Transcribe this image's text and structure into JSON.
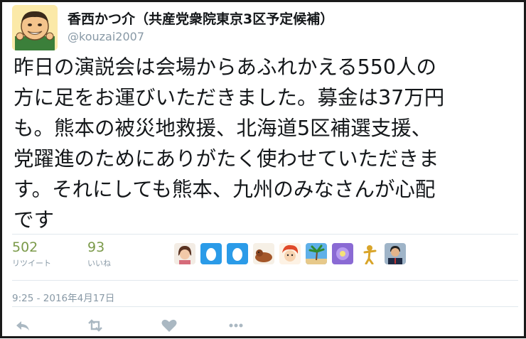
{
  "tweet": {
    "display_name": "香西かつ介（共産党衆院東京3区予定候補）",
    "handle": "@kouzai2007",
    "text_lines": [
      "昨日の演説会は会場からあふれかえる550人の",
      "方に足をお運びいただきました。募金は37万円",
      "も。熊本の被災地救援、北海道5区補選支援、",
      "党躍進のためにありがたく使わせていただきま",
      "す。それにしても熊本、九州のみなさんが心配",
      "です"
    ],
    "retweets": {
      "count": "502",
      "label": "リツイート"
    },
    "likes": {
      "count": "93",
      "label": "いいね"
    },
    "timestamp": "9:25 - 2016年4月17日",
    "liker_avatars": [
      "woman-avatar",
      "egg-avatar",
      "egg-avatar",
      "dog-avatar",
      "cartoon-avatar",
      "palm-tree-avatar",
      "purple-flower-avatar",
      "figure-avatar",
      "man-avatar"
    ],
    "actions": [
      "reply-icon",
      "retweet-icon",
      "like-icon",
      "more-icon"
    ],
    "colors": {
      "stat_number": "#7b9a4a",
      "muted": "#8899a6",
      "text": "#14171a",
      "divider": "#e1e8ed",
      "egg_bg": "#2b9be8"
    }
  }
}
